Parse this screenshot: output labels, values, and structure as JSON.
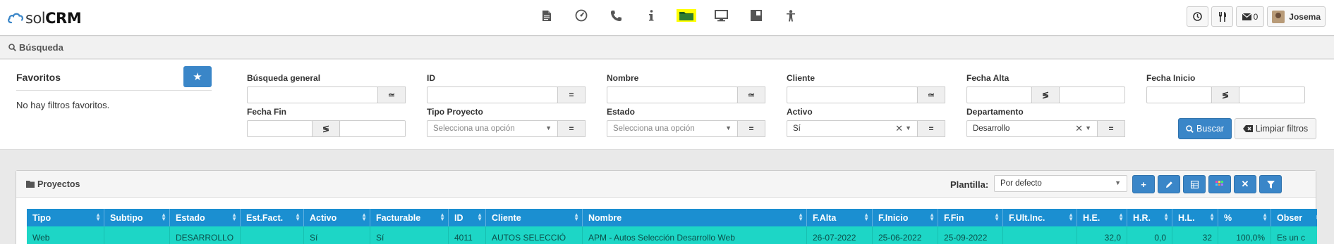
{
  "brand": {
    "part1": "sol",
    "part2": "CRM",
    "color": "#3a86c8"
  },
  "nav_icons": [
    "document-icon",
    "dashboard-icon",
    "phone-icon",
    "info-icon",
    "folder-icon",
    "monitor-icon",
    "board-icon",
    "person-icon"
  ],
  "header_right": {
    "notifications_count": "0",
    "user_name": "Josema"
  },
  "search_bar": {
    "title": "Búsqueda"
  },
  "favorites": {
    "title": "Favoritos",
    "empty_text": "No hay filtros favoritos."
  },
  "filters": {
    "busqueda_general": {
      "label": "Búsqueda general",
      "op": "≃"
    },
    "id": {
      "label": "ID",
      "op": "="
    },
    "nombre": {
      "label": "Nombre",
      "op": "≃"
    },
    "cliente": {
      "label": "Cliente",
      "op": "≃"
    },
    "fecha_alta": {
      "label": "Fecha Alta",
      "op": "≶"
    },
    "fecha_inicio": {
      "label": "Fecha Inicio",
      "op": "≶"
    },
    "fecha_fin": {
      "label": "Fecha Fin",
      "op": "≶"
    },
    "tipo_proyecto": {
      "label": "Tipo Proyecto",
      "placeholder": "Selecciona una opción",
      "op": "="
    },
    "estado": {
      "label": "Estado",
      "placeholder": "Selecciona una opción",
      "op": "="
    },
    "activo": {
      "label": "Activo",
      "value": "Sí",
      "op": "="
    },
    "departamento": {
      "label": "Departamento",
      "value": "Desarrollo",
      "op": "="
    }
  },
  "actions": {
    "search_label": "Buscar",
    "clear_label": "Limpiar filtros"
  },
  "panel": {
    "title": "Proyectos",
    "plantilla_label": "Plantilla:",
    "plantilla_value": "Por defecto"
  },
  "table": {
    "columns": [
      "Tipo",
      "Subtipo",
      "Estado",
      "Est.Fact.",
      "Activo",
      "Facturable",
      "ID",
      "Cliente",
      "Nombre",
      "F.Alta",
      "F.Inicio",
      "F.Fin",
      "F.Ult.Inc.",
      "H.E.",
      "H.R.",
      "H.L.",
      "%",
      "Obser"
    ],
    "rows": [
      [
        "Web",
        "",
        "DESARROLLO",
        "",
        "Sí",
        "Sí",
        "4011",
        "AUTOS SELECCIÓ",
        "APM - Autos Selección Desarrollo Web",
        "26-07-2022",
        "25-06-2022",
        "25-09-2022",
        "",
        "32,0",
        "0,0",
        "32",
        "100,0%",
        "Es un c"
      ]
    ],
    "header_color": "#1b8fd1",
    "row_color": "#1dd6c6"
  }
}
